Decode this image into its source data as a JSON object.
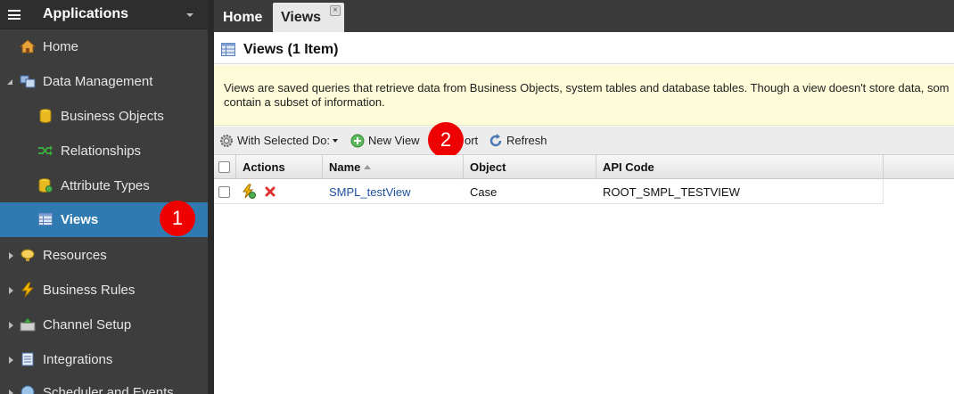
{
  "sidebar": {
    "title": "Applications",
    "items": [
      {
        "label": "Home",
        "icon": "home-icon"
      },
      {
        "label": "Data Management",
        "icon": "data-management-icon"
      },
      {
        "label": "Business Objects",
        "icon": "database-icon"
      },
      {
        "label": "Relationships",
        "icon": "relationships-icon"
      },
      {
        "label": "Attribute Types",
        "icon": "attribute-types-icon"
      },
      {
        "label": "Views",
        "icon": "views-icon"
      },
      {
        "label": "Resources",
        "icon": "resources-icon"
      },
      {
        "label": "Business Rules",
        "icon": "lightning-icon"
      },
      {
        "label": "Channel Setup",
        "icon": "channel-setup-icon"
      },
      {
        "label": "Integrations",
        "icon": "integrations-icon"
      },
      {
        "label": "Scheduler and Events",
        "icon": "scheduler-icon"
      }
    ]
  },
  "badges": {
    "one": "1",
    "two": "2"
  },
  "tabs": {
    "home": "Home",
    "views": "Views",
    "close": "×"
  },
  "page": {
    "title": "Views (1 Item)",
    "info_line1": "Views are saved queries that retrieve data from Business Objects, system tables and database tables. Though a view doesn't store data, som",
    "info_line2": "contain a subset of information."
  },
  "toolbar": {
    "with_selected": "With Selected Do:",
    "new_view": "New View",
    "import_partial": "ort",
    "refresh": "Refresh"
  },
  "grid": {
    "columns": [
      "Actions",
      "Name",
      "Object",
      "API Code"
    ],
    "rows": [
      {
        "name": "SMPL_testView",
        "object": "Case",
        "api_code": "ROOT_SMPL_TESTVIEW"
      }
    ]
  },
  "colors": {
    "accent": "#2f7bb1",
    "badge": "#ee0000",
    "info_bg": "#fdfbd8"
  }
}
